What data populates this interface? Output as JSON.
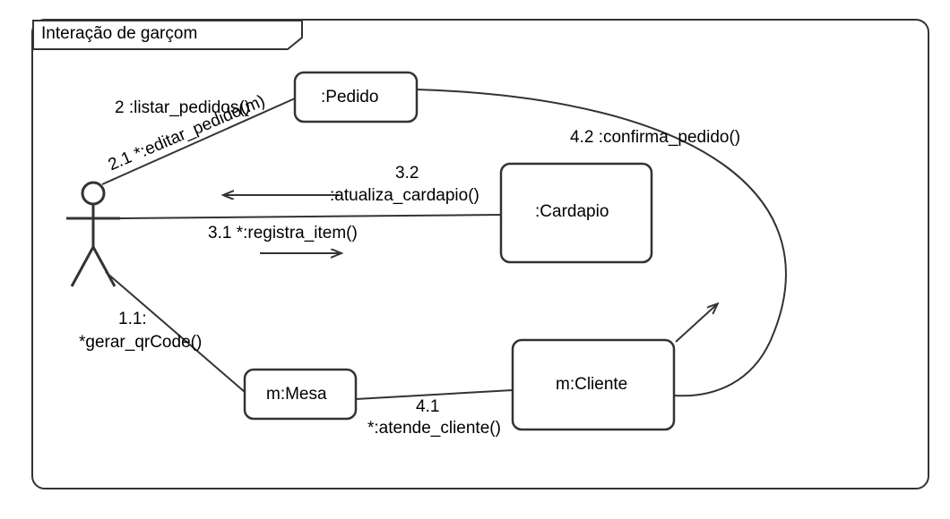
{
  "diagram": {
    "frame_title": "Interação de garçom",
    "nodes": {
      "pedido": ":Pedido",
      "cardapio": ":Cardapio",
      "mesa": "m:Mesa",
      "cliente": "m:Cliente"
    },
    "messages": {
      "m2": "2 :listar_pedidos()",
      "m21": "2.1 *:editar_pedido(m)",
      "m32_seq": "3.2",
      "m32_name": ":atualiza_cardapio()",
      "m31": "3.1 *:registra_item()",
      "m11_seq": "1.1:",
      "m11_name": "*gerar_qrCode()",
      "m41_seq": "4.1",
      "m41_name": "*:atende_cliente()",
      "m42": "4.2 :confirma_pedido()"
    }
  }
}
